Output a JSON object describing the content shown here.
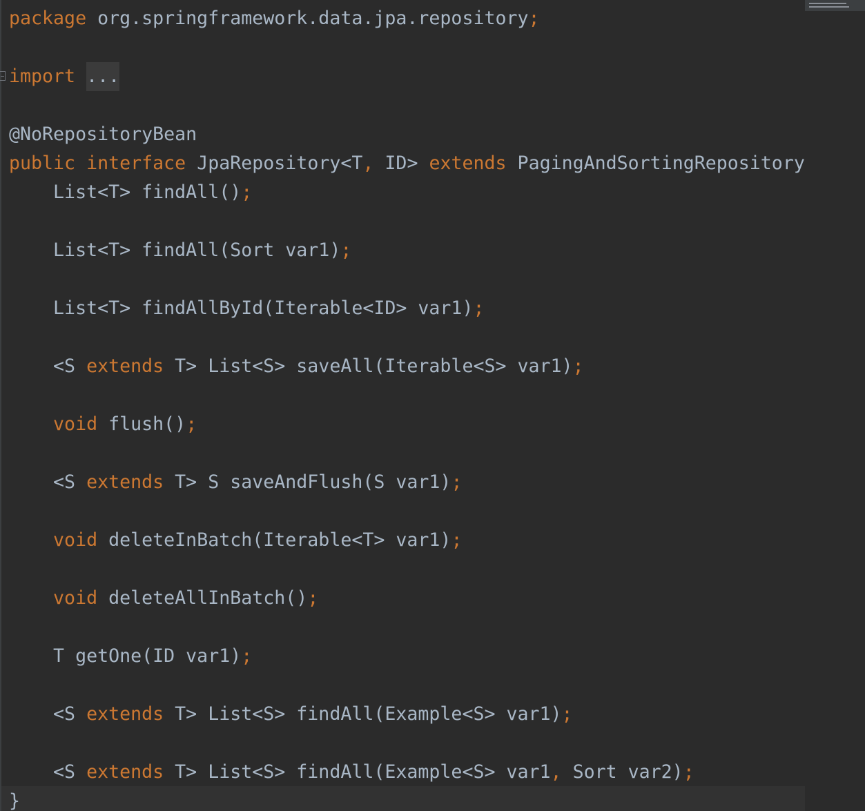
{
  "editor": {
    "lines": [
      [
        {
          "t": "package",
          "c": "kw"
        },
        {
          "t": " org.springframework.data.jpa.repository",
          "c": "pl"
        },
        {
          "t": ";",
          "c": "kw"
        }
      ],
      [],
      [
        {
          "t": "import",
          "c": "kw"
        },
        {
          "t": " ",
          "c": "pl"
        },
        {
          "t": "...",
          "c": "fold"
        }
      ],
      [],
      [
        {
          "t": "@NoRepositoryBean",
          "c": "pl"
        }
      ],
      [
        {
          "t": "public",
          "c": "kw"
        },
        {
          "t": " ",
          "c": "pl"
        },
        {
          "t": "interface",
          "c": "kw"
        },
        {
          "t": " JpaRepository<T",
          "c": "pl"
        },
        {
          "t": ",",
          "c": "kw"
        },
        {
          "t": " ID> ",
          "c": "pl"
        },
        {
          "t": "extends",
          "c": "kw"
        },
        {
          "t": " PagingAndSortingRepository",
          "c": "pl"
        }
      ],
      [
        {
          "t": "    List<T> findAll()",
          "c": "pl"
        },
        {
          "t": ";",
          "c": "kw"
        }
      ],
      [],
      [
        {
          "t": "    List<T> findAll(Sort var1)",
          "c": "pl"
        },
        {
          "t": ";",
          "c": "kw"
        }
      ],
      [],
      [
        {
          "t": "    List<T> findAllById(Iterable<ID> var1)",
          "c": "pl"
        },
        {
          "t": ";",
          "c": "kw"
        }
      ],
      [],
      [
        {
          "t": "    <S ",
          "c": "pl"
        },
        {
          "t": "extends",
          "c": "kw"
        },
        {
          "t": " T> List<S> saveAll(Iterable<S> var1)",
          "c": "pl"
        },
        {
          "t": ";",
          "c": "kw"
        }
      ],
      [],
      [
        {
          "t": "    ",
          "c": "pl"
        },
        {
          "t": "void",
          "c": "kw"
        },
        {
          "t": " flush()",
          "c": "pl"
        },
        {
          "t": ";",
          "c": "kw"
        }
      ],
      [],
      [
        {
          "t": "    <S ",
          "c": "pl"
        },
        {
          "t": "extends",
          "c": "kw"
        },
        {
          "t": " T> S saveAndFlush(S var1)",
          "c": "pl"
        },
        {
          "t": ";",
          "c": "kw"
        }
      ],
      [],
      [
        {
          "t": "    ",
          "c": "pl"
        },
        {
          "t": "void",
          "c": "kw"
        },
        {
          "t": " deleteInBatch(Iterable<T> var1)",
          "c": "pl"
        },
        {
          "t": ";",
          "c": "kw"
        }
      ],
      [],
      [
        {
          "t": "    ",
          "c": "pl"
        },
        {
          "t": "void",
          "c": "kw"
        },
        {
          "t": " deleteAllInBatch()",
          "c": "pl"
        },
        {
          "t": ";",
          "c": "kw"
        }
      ],
      [],
      [
        {
          "t": "    T getOne(ID var1)",
          "c": "pl"
        },
        {
          "t": ";",
          "c": "kw"
        }
      ],
      [],
      [
        {
          "t": "    <S ",
          "c": "pl"
        },
        {
          "t": "extends",
          "c": "kw"
        },
        {
          "t": " T> List<S> findAll(Example<S> var1)",
          "c": "pl"
        },
        {
          "t": ";",
          "c": "kw"
        }
      ],
      [],
      [
        {
          "t": "    <S ",
          "c": "pl"
        },
        {
          "t": "extends",
          "c": "kw"
        },
        {
          "t": " T> List<S> findAll(Example<S> var1",
          "c": "pl"
        },
        {
          "t": ",",
          "c": "kw"
        },
        {
          "t": " Sort var2)",
          "c": "pl"
        },
        {
          "t": ";",
          "c": "kw"
        }
      ],
      [
        {
          "t": "}",
          "c": "pl"
        }
      ]
    ]
  },
  "colors": {
    "background": "#2b2b2b",
    "keyword": "#cc7832",
    "plain": "#a9b7c6",
    "fold_background": "#3b3b3b",
    "current_line": "#323232"
  }
}
